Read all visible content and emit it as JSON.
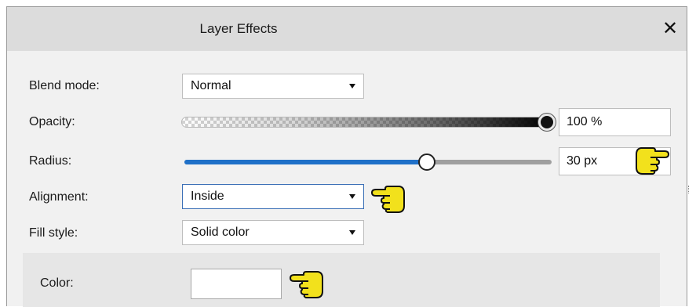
{
  "dialog": {
    "title": "Layer Effects",
    "close_glyph": "✕"
  },
  "fields": {
    "blend_mode": {
      "label": "Blend mode:",
      "value": "Normal"
    },
    "opacity": {
      "label": "Opacity:",
      "value": "100 %",
      "level": 1.0
    },
    "radius": {
      "label": "Radius:",
      "value": "30 px",
      "level": 0.66
    },
    "alignment": {
      "label": "Alignment:",
      "value": "Inside"
    },
    "fill_style": {
      "label": "Fill style:",
      "value": "Solid color"
    },
    "color": {
      "label": "Color:",
      "swatch": "#ffffff"
    }
  },
  "colors": {
    "accent": "#1f70c8",
    "pointer_hand": "#f2e11c"
  },
  "icons": [
    "close-icon",
    "chevron-down-icon",
    "pointing-hand-icon"
  ]
}
